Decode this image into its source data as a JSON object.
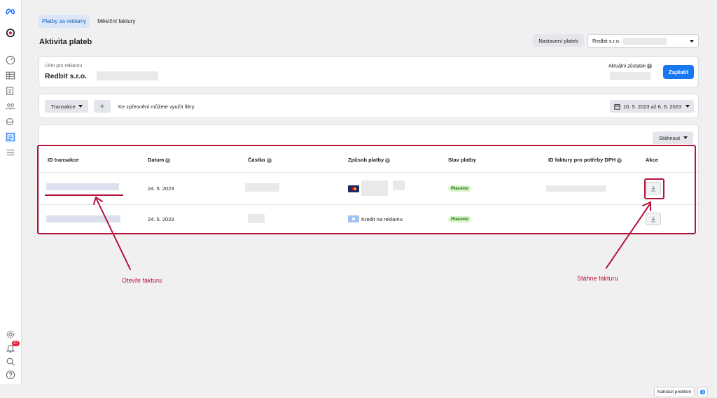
{
  "tabs": [
    {
      "label": "Platby za reklamy"
    },
    {
      "label": "Měsíční faktury"
    }
  ],
  "page_title": "Aktivita plateb",
  "header": {
    "settings_button": "Nastavení plateb",
    "account_select": "Redbit s.r.o."
  },
  "account_card": {
    "label": "Účet pro reklamu",
    "name": "Redbit s.r.o.",
    "balance_label": "Aktuální zůstatek",
    "pay_button": "Zaplatit"
  },
  "filters": {
    "transactions_button": "Transakce",
    "add_button": "+",
    "hint": "Ke zpřesnění můžete využít filtry.",
    "date_range": "10. 5. 2023 až 6. 6. 2023"
  },
  "table": {
    "download_button": "Stáhnout",
    "columns": [
      "ID transakce",
      "Datum",
      "Částka",
      "Způsob platby",
      "Stav platby",
      "ID faktury pro potřeby DPH",
      "Akce"
    ],
    "rows": [
      {
        "date": "24. 5. 2023",
        "payment_method": "",
        "status": "Placeno"
      },
      {
        "date": "24. 5. 2023",
        "payment_method": "Kredit na reklamu",
        "status": "Placeno"
      }
    ]
  },
  "annotations": {
    "open_invoice": "Otevře fakturu",
    "download_invoice": "Stáhne fakturu"
  },
  "footer": {
    "report_button": "Nahlásit problém"
  },
  "notifications": {
    "count": "27"
  },
  "colors": {
    "accent": "#1877f2",
    "annotation": "#b5133a",
    "paid_bg": "#d6f5c8",
    "paid_text": "#1d6b12"
  },
  "icons": [
    "meta-logo-icon",
    "brand-icon",
    "speedometer-icon",
    "table-icon",
    "pages-icon",
    "audience-icon",
    "coins-icon",
    "billing-icon",
    "menu-icon",
    "gear-icon",
    "bell-icon",
    "search-icon",
    "help-icon",
    "calendar-icon",
    "download-icon",
    "globe-icon"
  ]
}
